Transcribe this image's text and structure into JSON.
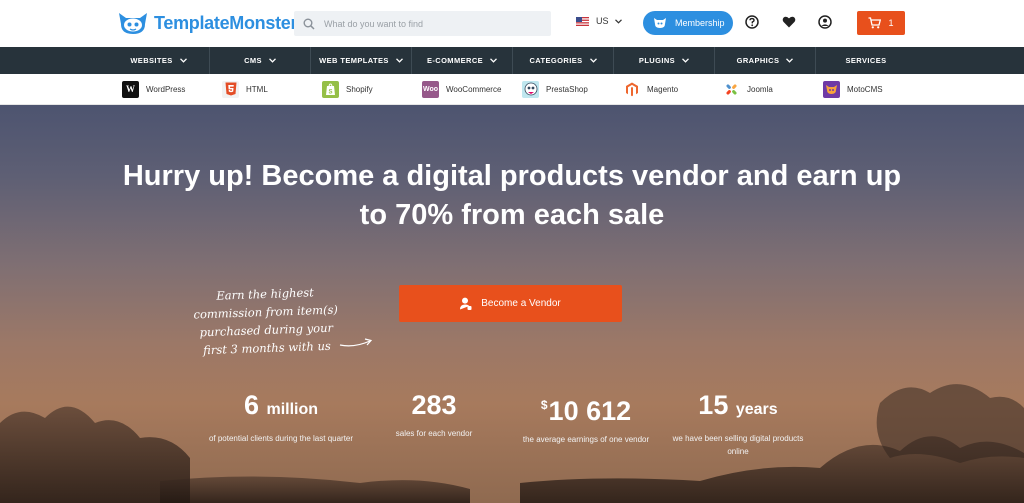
{
  "header": {
    "logo_text": "TemplateMonster",
    "search": {
      "placeholder": "What do you want to find"
    },
    "locale": {
      "label": "US"
    },
    "membership_label": "Membership",
    "cart_count": "1",
    "colors": {
      "brand_blue": "#2d8fe0",
      "accent_orange": "#e8501c",
      "nav_dark": "#27333b"
    }
  },
  "nav": {
    "categories": [
      {
        "label": "WEBSITES",
        "dropdown": true
      },
      {
        "label": "CMS",
        "dropdown": true
      },
      {
        "label": "WEB TEMPLATES",
        "dropdown": true
      },
      {
        "label": "E-COMMERCE",
        "dropdown": true
      },
      {
        "label": "CATEGORIES",
        "dropdown": true
      },
      {
        "label": "PLUGINS",
        "dropdown": true
      },
      {
        "label": "GRAPHICS",
        "dropdown": true
      },
      {
        "label": "SERVICES",
        "dropdown": false
      }
    ],
    "platforms": [
      {
        "label": "WordPress",
        "icon": "wordpress-icon"
      },
      {
        "label": "HTML",
        "icon": "html5-icon"
      },
      {
        "label": "Shopify",
        "icon": "shopify-icon"
      },
      {
        "label": "WooCommerce",
        "icon": "woocommerce-icon"
      },
      {
        "label": "PrestaShop",
        "icon": "prestashop-icon"
      },
      {
        "label": "Magento",
        "icon": "magento-icon"
      },
      {
        "label": "Joomla",
        "icon": "joomla-icon"
      },
      {
        "label": "MotoCMS",
        "icon": "motocms-icon"
      }
    ]
  },
  "hero": {
    "title": "Hurry up! Become a digital products vendor and earn up to 70% from each sale",
    "promo_note": "Earn the highest commission from item(s) purchased during your first 3 months with us",
    "cta_label": "Become a Vendor",
    "stats": [
      {
        "value": "6",
        "unit": "million",
        "desc": "of potential clients during the last quarter"
      },
      {
        "value": "283",
        "unit": "",
        "desc": "sales for each vendor"
      },
      {
        "currency": "$",
        "value": "10 612",
        "unit": "",
        "desc": "the average earnings of one vendor"
      },
      {
        "value": "15",
        "unit": "years",
        "desc": "we have been selling digital products online"
      }
    ]
  }
}
